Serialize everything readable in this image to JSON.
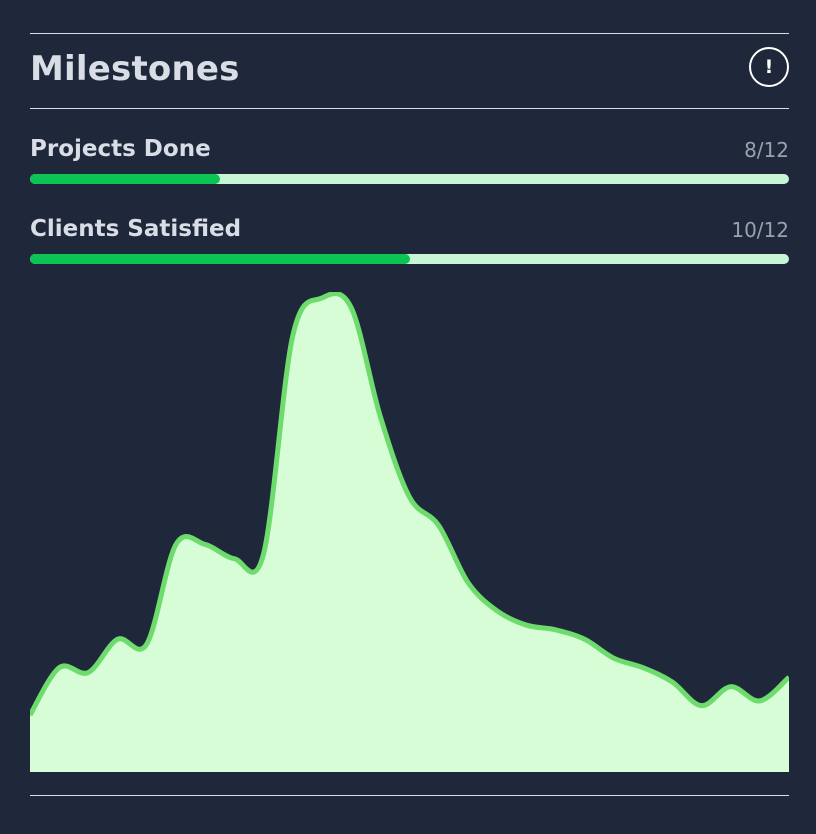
{
  "milestones": {
    "title": "Milestones",
    "info_icon": "!",
    "metrics": [
      {
        "label": "Projects Done",
        "value": "8/12",
        "progress": 0.25
      },
      {
        "label": "Clients Satisfied",
        "value": "10/12",
        "progress": 0.5
      }
    ]
  },
  "colors": {
    "background": "#1f283a",
    "text": "#d9dde6",
    "muted_text": "#9aa1ae",
    "progress_fill": "#0bc453",
    "progress_track": "#c6f6d5",
    "area_fill": "#d6fdd5",
    "area_line": "#6ddc6d"
  },
  "chart_data": {
    "type": "area",
    "x": [
      0,
      1,
      2,
      3,
      4,
      5,
      6,
      7,
      8,
      9,
      10,
      11,
      12,
      13,
      14,
      15,
      16,
      17,
      18,
      19,
      20,
      21,
      22,
      23,
      24,
      25,
      26
    ],
    "values": [
      12,
      22,
      21,
      28,
      27,
      48,
      48,
      45,
      46,
      92,
      100,
      98,
      75,
      58,
      52,
      40,
      34,
      31,
      30,
      28,
      24,
      22,
      19,
      14,
      18,
      15,
      20
    ],
    "ylim": [
      0,
      100
    ],
    "grid": false,
    "title": "",
    "xlabel": "",
    "ylabel": ""
  }
}
